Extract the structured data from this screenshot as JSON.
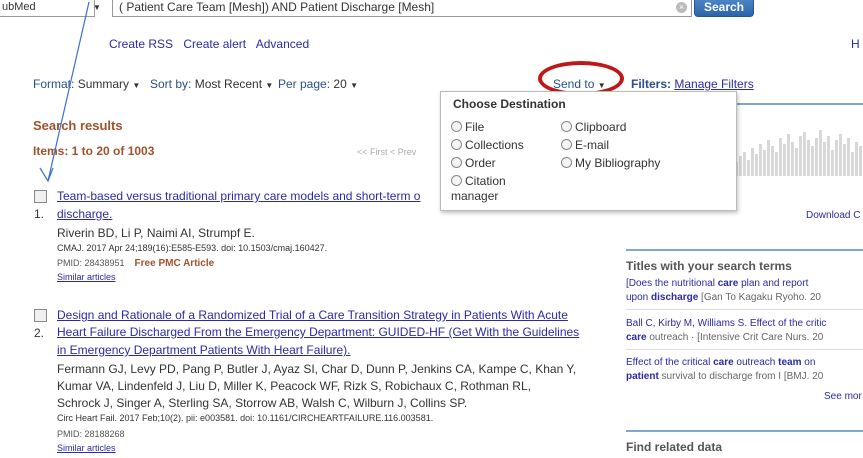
{
  "header": {
    "database": "ubMed",
    "query": "( Patient Care Team [Mesh]) AND  Patient Discharge [Mesh]",
    "search_label": "Search",
    "links": [
      "Create RSS",
      "Create alert",
      "Advanced"
    ],
    "help_fragment": "H"
  },
  "display_settings": {
    "format_label": "Format:",
    "format_value": "Summary",
    "sort_label": "Sort by:",
    "sort_value": "Most Recent",
    "perpage_label": "Per page:",
    "perpage_value": "20"
  },
  "send_to": {
    "label": "Send to",
    "filters_label": "Filters:",
    "manage_filters": "Manage Filters"
  },
  "destination": {
    "title": "Choose Destination",
    "left_options": [
      "File",
      "Collections",
      "Order",
      "Citation"
    ],
    "citation_second_line": "manager",
    "right_options": [
      "Clipboard",
      "E-mail",
      "My Bibliography"
    ]
  },
  "results": {
    "heading": "Search results",
    "items_text": "Items: 1 to 20 of 1003",
    "pager": "<< First   < Prev",
    "list": [
      {
        "number": "1.",
        "title_lines": [
          "Team-based versus traditional primary care models and short-term o",
          "discharge."
        ],
        "authors": [
          "Riverin BD, Li P, Naimi AI, Strumpf E."
        ],
        "citation": "CMAJ. 2017 Apr 24;189(16):E585-E593. doi: 10.1503/cmaj.160427.",
        "pmid": "PMID: 28438951",
        "free": "Free PMC Article",
        "similar": "Similar articles"
      },
      {
        "number": "2.",
        "title_lines": [
          "Design and Rationale of a Randomized Trial of a Care Transition Strategy in Patients With Acute",
          "Heart Failure Discharged From the Emergency Department: GUIDED-HF (Get With the Guidelines",
          "in Emergency Department Patients With Heart Failure)."
        ],
        "authors": [
          "Fermann GJ, Levy PD, Pang P, Butler J, Ayaz SI, Char D, Dunn P, Jenkins CA, Kampe C, Khan Y,",
          "Kumar VA, Lindenfeld J, Liu D, Miller K, Peacock WF, Rizk S, Robichaux C, Rothman RL,",
          "Schrock J, Singer A, Sterling SA, Storrow AB, Walsh C, Wilburn J, Collins SP."
        ],
        "citation": "Circ Heart Fail. 2017 Feb;10(2). pii: e003581. doi: 10.1161/CIRCHEARTFAILURE.116.003581.",
        "pmid": "PMID: 28188268",
        "free": "",
        "similar": "Similar articles"
      }
    ]
  },
  "sidebar": {
    "download": "Download C",
    "titles_heading": "Titles with your search terms",
    "titles": [
      {
        "line1_pre": "[Does the nutritional ",
        "line1_b": "care",
        "line1_post": " plan and report",
        "line2_pre": "upon ",
        "line2_b": "discharge",
        "line2_src": " [Gan To Kagaku Ryoho. 20"
      },
      {
        "line1_pre": "Ball C, Kirby M, Williams S. Effect of the critic",
        "line1_b": "",
        "line1_post": "",
        "line2_pre": "",
        "line2_b": "care",
        "line2_src": " outreach · [Intensive Crit Care Nurs. 20"
      },
      {
        "line1_pre": "Effect of the critical ",
        "line1_b": "care",
        "line1_post": " outreach ",
        "line1_b2": "team",
        "line1_post2": " on",
        "line2_pre": "",
        "line2_b": "patient",
        "line2_src": " survival to discharge from I [BMJ. 20"
      }
    ],
    "see_more": "See mor",
    "find_related": "Find related data"
  }
}
